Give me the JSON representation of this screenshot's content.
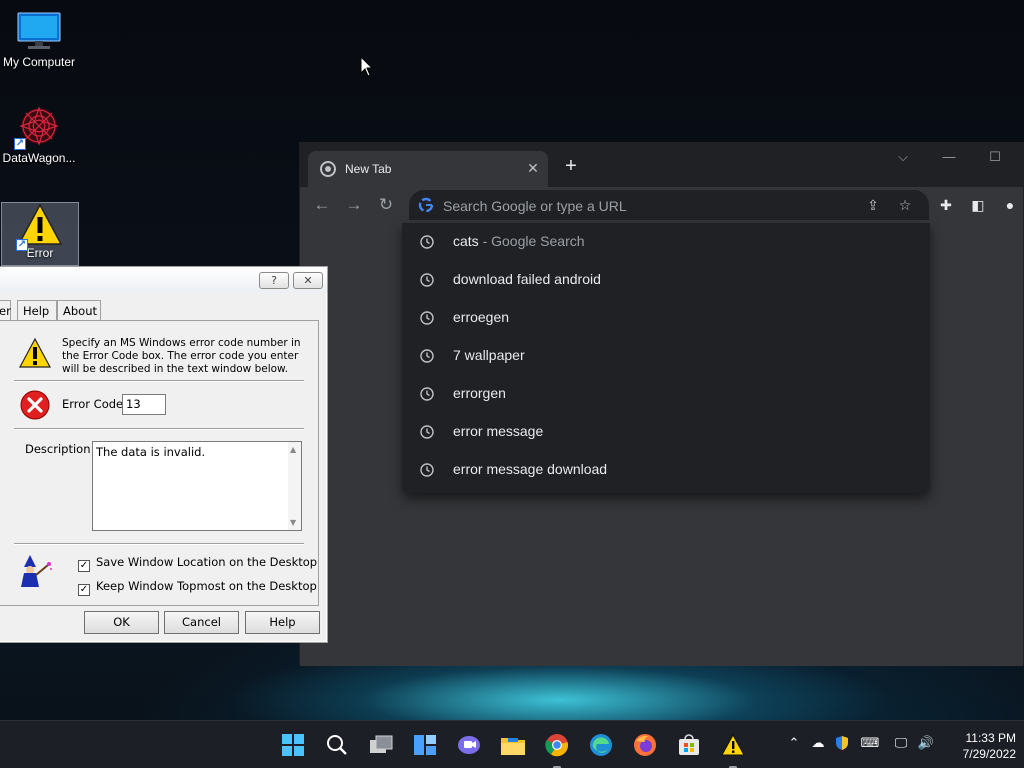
{
  "desktop": {
    "icons": [
      {
        "label": "My Computer",
        "icon": "monitor-icon"
      },
      {
        "label": "DataWagon...",
        "icon": "datawagon-icon"
      },
      {
        "label": "Error",
        "icon": "warning-icon"
      }
    ]
  },
  "chrome": {
    "tab_title": "New Tab",
    "new_tab_symbol": "+",
    "omnibox_placeholder": "Search Google or type a URL",
    "suggestions": [
      {
        "text": "cats",
        "suffix": " - Google Search"
      },
      {
        "text": "download failed android",
        "suffix": ""
      },
      {
        "text": "erroegen",
        "suffix": ""
      },
      {
        "text": "7 wallpaper",
        "suffix": ""
      },
      {
        "text": "errorgen",
        "suffix": ""
      },
      {
        "text": "error message",
        "suffix": ""
      },
      {
        "text": "error message download",
        "suffix": ""
      }
    ],
    "colors": {
      "frame": "#202124",
      "toolbar": "#35363a",
      "text": "#e8eaed",
      "muted": "#9aa0a6"
    }
  },
  "dialog": {
    "title_help_symbol": "?",
    "title_close_symbol": "✕",
    "tabs": [
      "er",
      "Help",
      "About"
    ],
    "intro": "Specify an MS Windows error code number in the Error Code box. The error code you enter will be described in the text window below.",
    "error_code_label": "Error Code",
    "error_code_value": "13",
    "description_label": "Description",
    "description_value": "The data is invalid.",
    "checkbox_save": {
      "label": "Save Window Location on the Desktop",
      "checked": true
    },
    "checkbox_topmost": {
      "label": "Keep Window Topmost on the Desktop",
      "checked": true
    },
    "buttons": {
      "ok": "OK",
      "cancel": "Cancel",
      "help": "Help"
    }
  },
  "taskbar": {
    "clock_time": "11:33 PM",
    "clock_date": "7/29/2022"
  }
}
